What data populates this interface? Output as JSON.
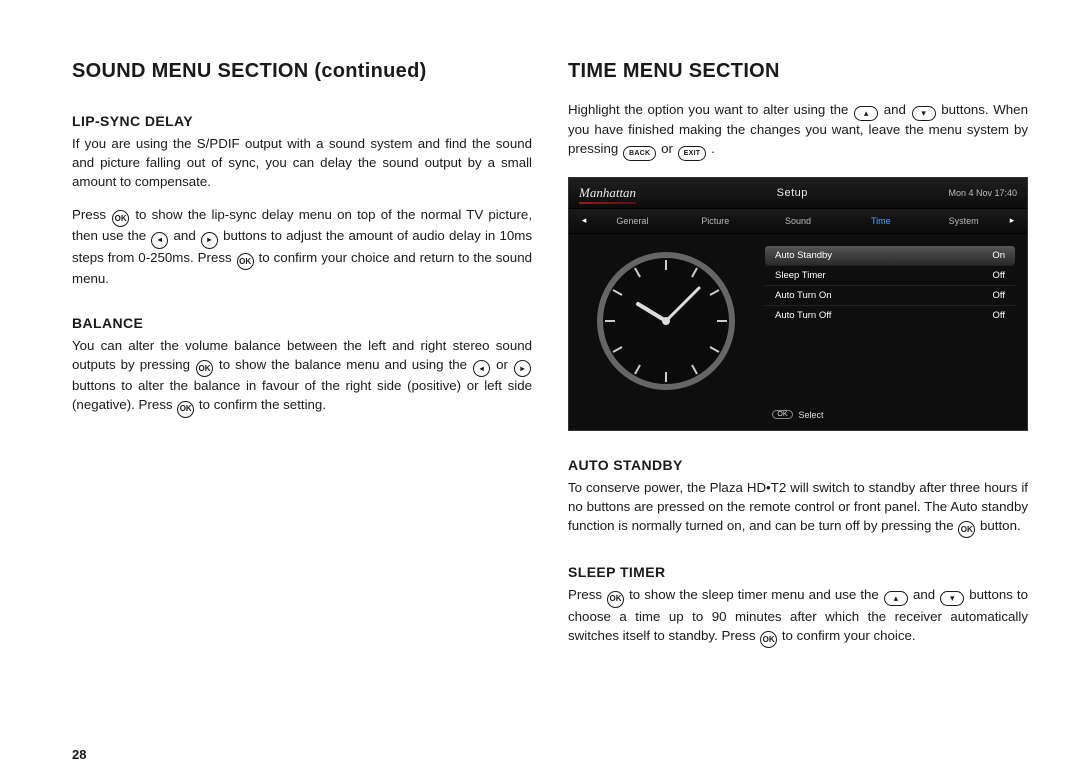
{
  "left": {
    "title": "SOUND MENU SECTION  (continued)",
    "h_lipsync": "LIP-SYNC DELAY",
    "p_lipsync1": "If you are using the S/PDIF output with a sound system and find the sound and picture falling out of sync, you can delay the sound output by a small amount to compensate.",
    "p_lipsync2a": "Press ",
    "p_lipsync2b": " to show the lip-sync delay menu on top of the normal TV picture, then use the ",
    "p_lipsync2c": " and ",
    "p_lipsync2d": " buttons to adjust the amount of audio delay in 10ms steps from 0-250ms. Press ",
    "p_lipsync2e": " to confirm your choice and return to the sound menu.",
    "h_balance": "BALANCE",
    "p_balanceA": "You can alter the volume balance between the left and right stereo sound outputs by pressing ",
    "p_balanceB": " to show the balance menu and using the ",
    "p_balanceC": " or ",
    "p_balanceD": " buttons to alter the balance in favour of the right side (positive) or left side (negative). Press ",
    "p_balanceE": " to confirm the setting.",
    "page": "28"
  },
  "right": {
    "title": "TIME MENU SECTION",
    "introA": "Highlight the option you want to alter using the ",
    "introB": " and ",
    "introC": " buttons. When you have finished making the changes you want, leave the menu system by pressing ",
    "introD": " or ",
    "introE": " .",
    "h_auto": "AUTO STANDBY",
    "p_autoA": "To conserve power, the Plaza HD•T2 will switch to standby after three hours if no buttons are pressed on the remote control or front panel. The Auto standby function is normally turned on, and can be turn off by pressing the ",
    "p_autoB": " button.",
    "h_sleep": "SLEEP TIMER",
    "p_sleepA": "Press ",
    "p_sleepB": " to show the sleep timer menu and use the ",
    "p_sleepC": " and ",
    "p_sleepD": " buttons to choose a time up to 90 minutes after which the receiver automatically switches itself to standby. Press ",
    "p_sleepE": " to confirm your choice."
  },
  "btn": {
    "ok": "OK",
    "back": "BACK",
    "exit": "EXIT",
    "left": "◂",
    "right": "▸",
    "up": "▴",
    "down": "▾"
  },
  "screen": {
    "brand": "Manhattan",
    "title": "Setup",
    "date": "Mon 4 Nov 17:40",
    "tabs": [
      "General",
      "Picture",
      "Sound",
      "Time",
      "System"
    ],
    "active_tab": 3,
    "rows": [
      {
        "label": "Auto Standby",
        "value": "On"
      },
      {
        "label": "Sleep Timer",
        "value": "Off"
      },
      {
        "label": "Auto Turn On",
        "value": "Off"
      },
      {
        "label": "Auto Turn Off",
        "value": "Off"
      }
    ],
    "footer_ok": "OK",
    "footer_label": "Select"
  }
}
